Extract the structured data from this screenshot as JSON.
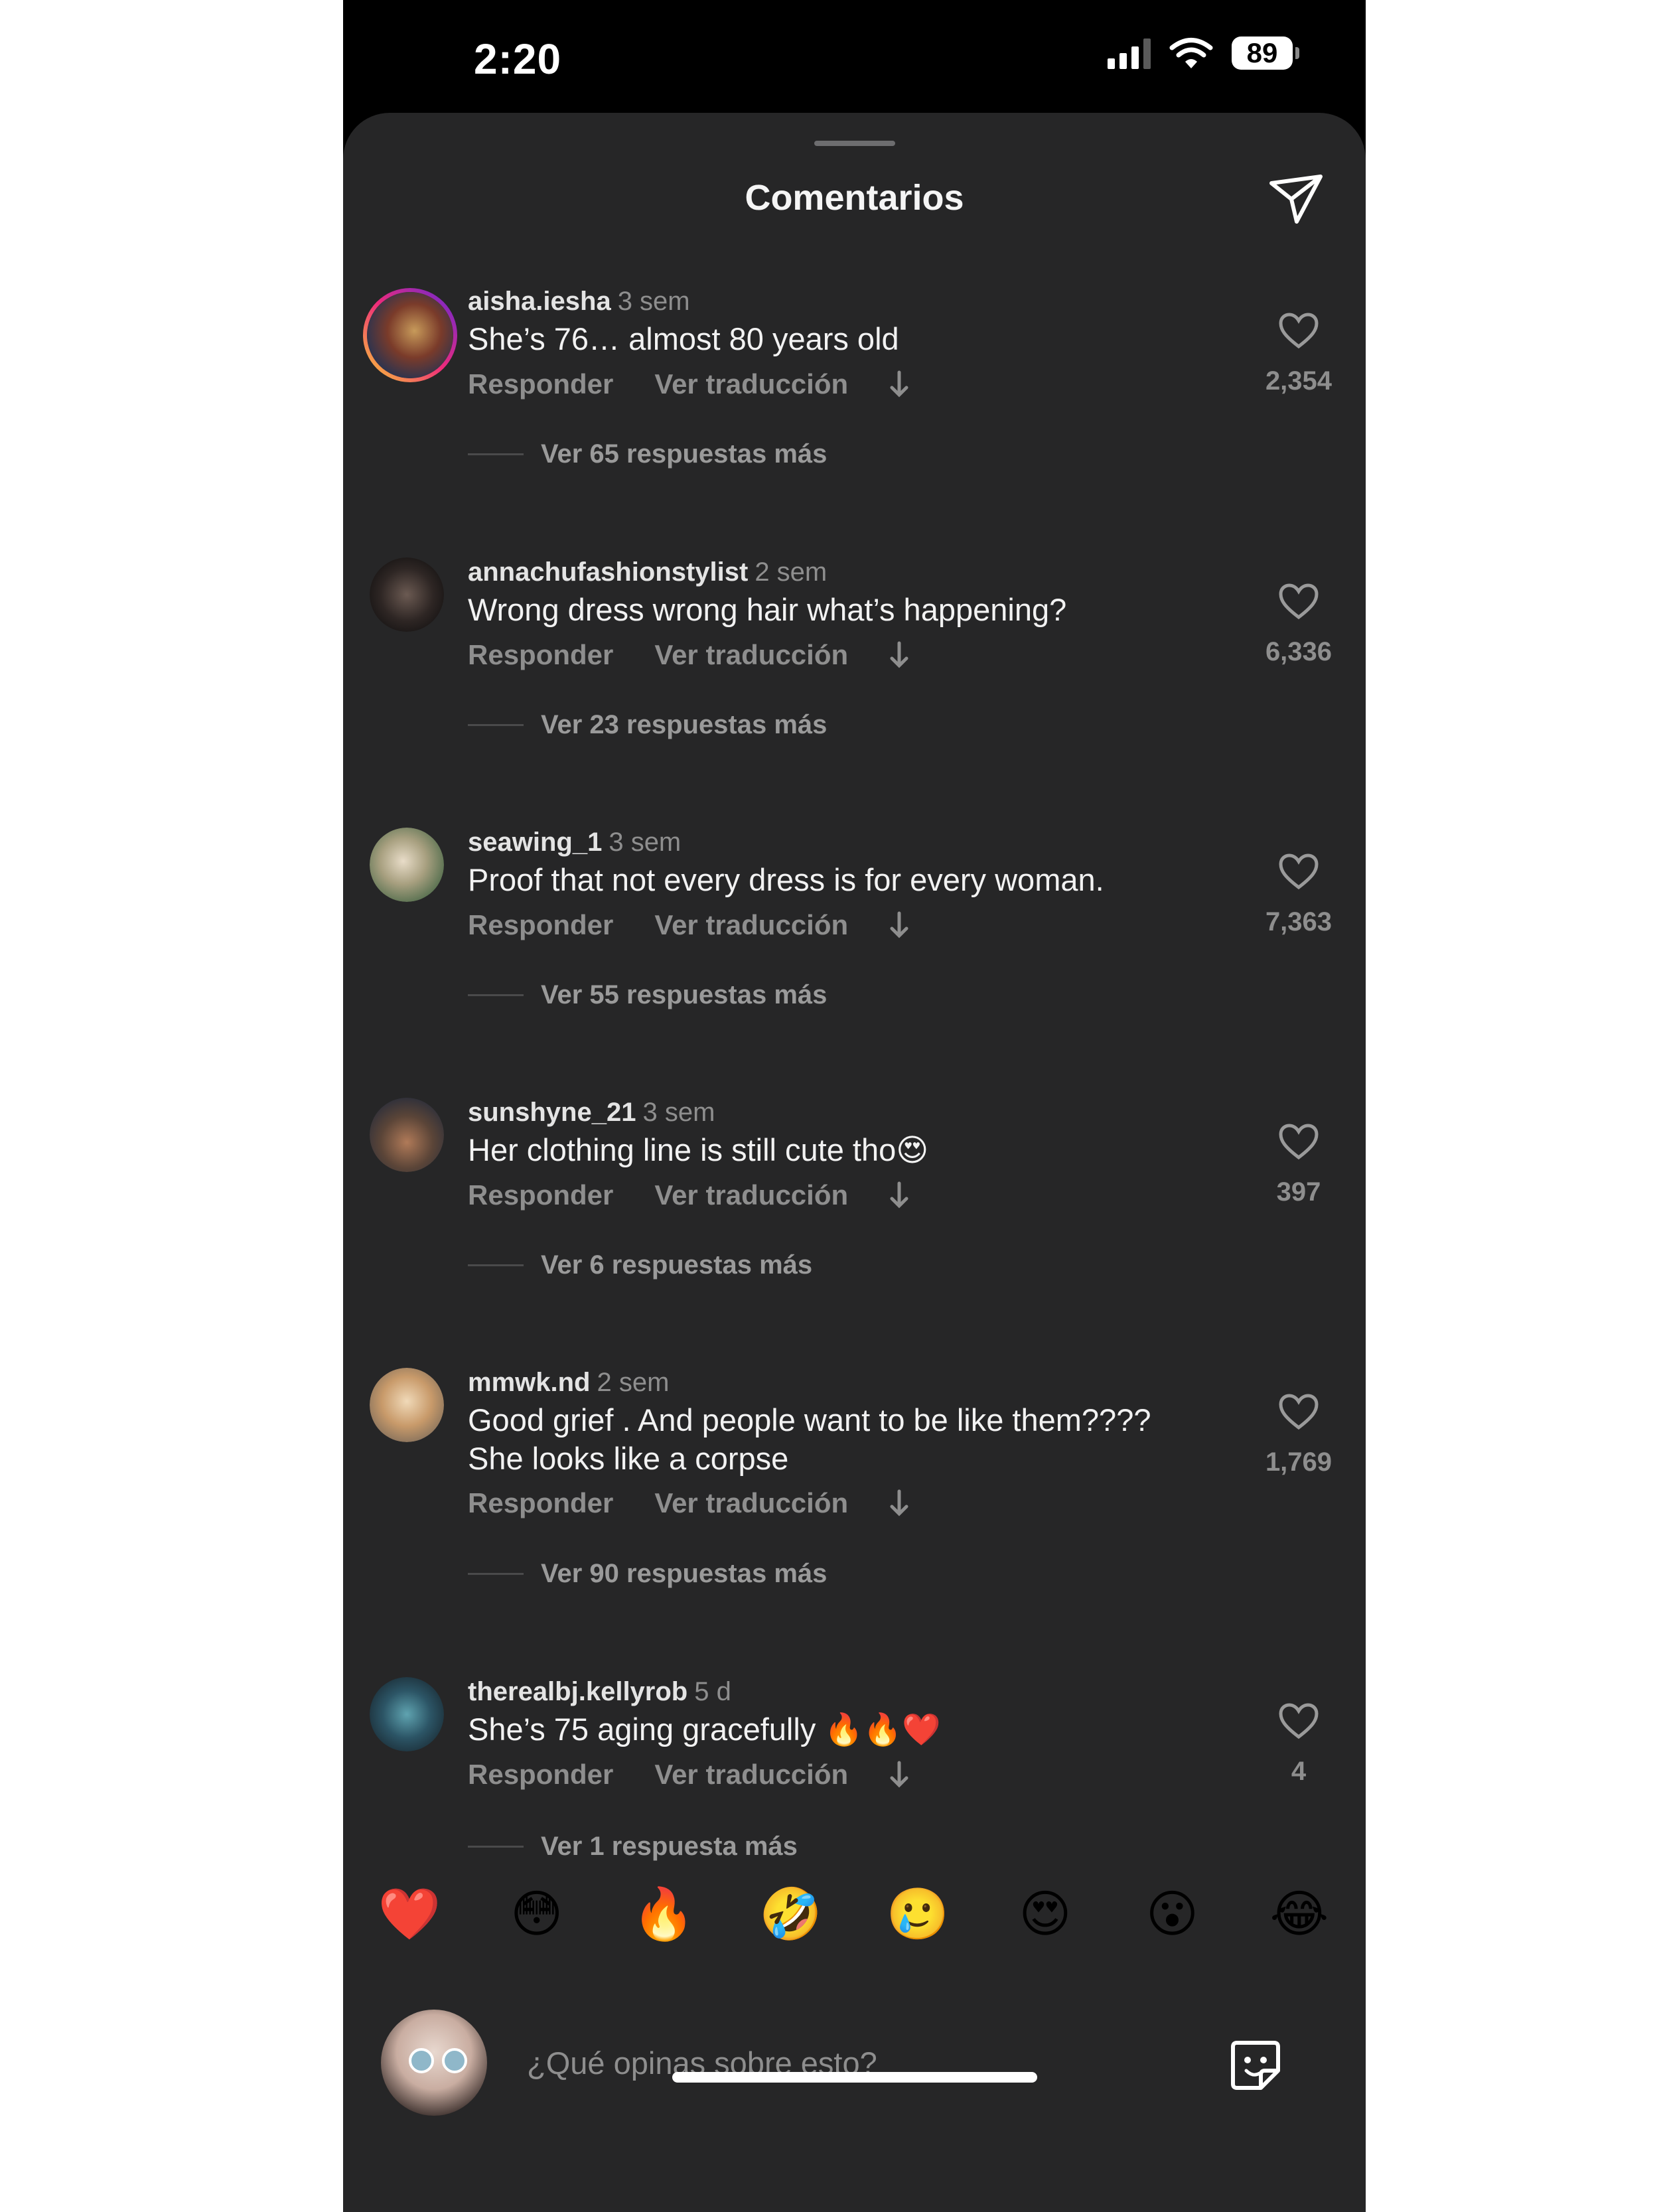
{
  "status_bar": {
    "time": "2:20",
    "battery": "89"
  },
  "header": {
    "title": "Comentarios"
  },
  "comments": [
    {
      "user": "aisha.iesha",
      "time": "3 sem",
      "text": "She’s 76… almost 80 years old",
      "reply": "Responder",
      "translate": "Ver traducción",
      "likes": "2,354",
      "more_replies": "Ver 65 respuestas más"
    },
    {
      "user": "annachufashionstylist",
      "time": "2 sem",
      "text": "Wrong dress wrong hair what’s happening?",
      "reply": "Responder",
      "translate": "Ver traducción",
      "likes": "6,336",
      "more_replies": "Ver 23 respuestas más"
    },
    {
      "user": "seawing_1",
      "time": "3 sem",
      "text": "Proof that not every dress is for every woman.",
      "reply": "Responder",
      "translate": "Ver traducción",
      "likes": "7,363",
      "more_replies": "Ver 55 respuestas más"
    },
    {
      "user": "sunshyne_21",
      "time": "3 sem",
      "text": "Her clothing line is still cute tho😍",
      "reply": "Responder",
      "translate": "Ver traducción",
      "likes": "397",
      "more_replies": "Ver 6 respuestas más"
    },
    {
      "user": "mmwk.nd",
      "time": "2 sem",
      "text": "Good grief .  And people want to be like them???? She looks like a corpse",
      "reply": "Responder",
      "translate": "Ver traducción",
      "likes": "1,769",
      "more_replies": "Ver 90 respuestas más"
    },
    {
      "user": "therealbj.kellyrob",
      "time": "5 d",
      "text": "She’s 75 aging gracefully 🔥🔥❤️",
      "reply": "Responder",
      "translate": "Ver traducción",
      "likes": "4",
      "more_replies": "Ver 1 respuesta más"
    }
  ],
  "emoji_bar": [
    "❤️",
    "😳",
    "🔥",
    "🤣",
    "🥲",
    "😍",
    "😮",
    "😂"
  ],
  "composer": {
    "placeholder": "¿Qué opinas sobre esto?"
  }
}
